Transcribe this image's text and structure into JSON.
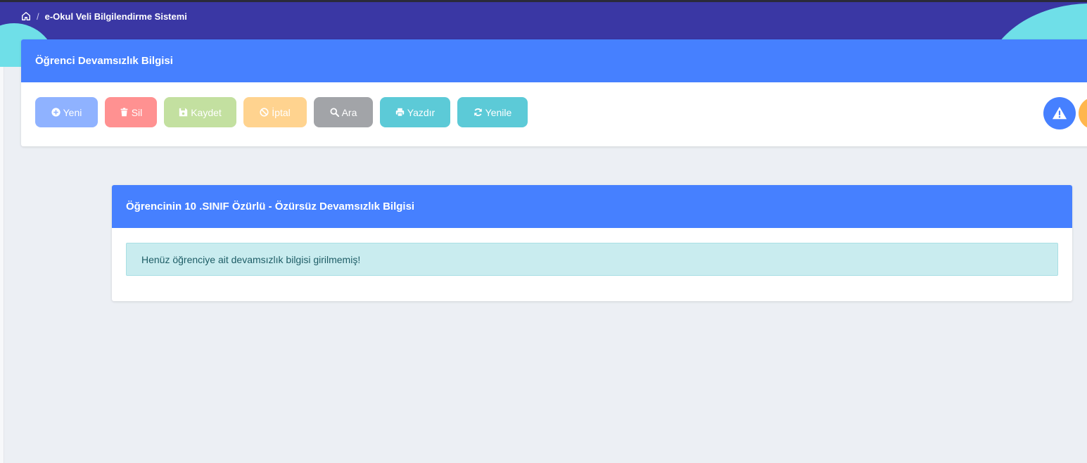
{
  "breadcrumb": {
    "home_icon": "home-icon",
    "separator": "/",
    "title": "e-Okul Veli Bilgilendirme Sistemi"
  },
  "main_card": {
    "title": "Öğrenci Devamsızlık Bilgisi"
  },
  "toolbar": {
    "yeni_label": "Yeni",
    "sil_label": "Sil",
    "kaydet_label": "Kaydet",
    "iptal_label": "İptal",
    "ara_label": "Ara",
    "yazdir_label": "Yazdır",
    "yenile_label": "Yenile"
  },
  "side_actions": {
    "warning_icon": "warning-icon",
    "orange_icon": "orange-action-icon"
  },
  "detail_card": {
    "title": "Öğrencinin 10 .SINIF Özürlü - Özürsüz Devamsızlık Bilgisi",
    "alert_text": "Henüz öğrenciye ait devamsızlık bilgisi girilmemiş!"
  },
  "colors": {
    "header_band": "#3a37a4",
    "card_header": "#4680ff",
    "accent_wave": "#6fdfe8",
    "alert_bg": "#c9ecef"
  }
}
